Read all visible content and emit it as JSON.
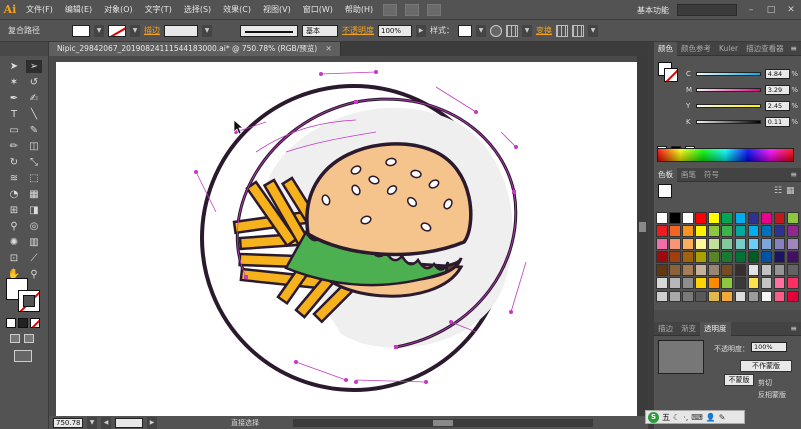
{
  "app": {
    "logo": "Ai"
  },
  "menu": [
    "文件(F)",
    "编辑(E)",
    "对象(O)",
    "文字(T)",
    "选择(S)",
    "效果(C)",
    "视图(V)",
    "窗口(W)",
    "帮助(H)"
  ],
  "workspace": "基本功能",
  "window_controls": [
    "–",
    "□",
    "✕"
  ],
  "control_bar": {
    "selection_label": "复合路径",
    "stroke_link": "描边",
    "stroke_weight_label": "",
    "brush_label": "基本",
    "opacity_link": "不透明度",
    "opacity_value": "100%",
    "style_label": "样式：",
    "transform_link": "变换"
  },
  "document_tab": {
    "title": "Nipic_29842067_20190824111544183000.ai* @ 750.78% (RGB/预览)",
    "close": "✕"
  },
  "status": {
    "zoom": "750.78",
    "page": "1",
    "status_text": "直接选择"
  },
  "panels": {
    "color_tabs": [
      "颜色",
      "颜色参考",
      "Kuler",
      "描边查看器"
    ],
    "cmyk": [
      {
        "label": "C",
        "value": "4.84",
        "color": "#00aeef"
      },
      {
        "label": "M",
        "value": "3.29",
        "color": "#ec008c"
      },
      {
        "label": "Y",
        "value": "2.45",
        "color": "#fff200"
      },
      {
        "label": "K",
        "value": "0.11",
        "color": "#000000"
      }
    ],
    "swatch_tabs": [
      "色板",
      "画笔",
      "符号"
    ],
    "swatches": [
      "#ffffff",
      "#000000",
      "#ffffff",
      "#ff0000",
      "#ffff00",
      "#00a651",
      "#00aeef",
      "#2e3192",
      "#ec008c",
      "#c4161c",
      "#8dc63f",
      "#ed1c24",
      "#f26522",
      "#f7941d",
      "#fff200",
      "#8dc63f",
      "#39b54a",
      "#00a99d",
      "#00aeef",
      "#0072bc",
      "#2e3192",
      "#92278f",
      "#f06eaa",
      "#f69679",
      "#fbaf5d",
      "#fff799",
      "#c4df9b",
      "#82ca9c",
      "#7accc8",
      "#6dcff6",
      "#7da7d9",
      "#8781bd",
      "#a186be",
      "#9e0b0f",
      "#a0410d",
      "#a3620a",
      "#aba000",
      "#598527",
      "#197b30",
      "#007236",
      "#005e20",
      "#0054a6",
      "#1b1464",
      "#440e62",
      "#603913",
      "#8c6239",
      "#a67c52",
      "#c7b299",
      "#998675",
      "#754c24",
      "#362f2d",
      "#e3e3e3",
      "#c2c2c2",
      "#959595",
      "#636363",
      "#d8d8d8",
      "#b7b7b7",
      "#8e8e8e",
      "#ffd400",
      "#ff8a00",
      "#8dc63f",
      "#3a3a3a",
      "#ffe14d",
      "#c4c4c4",
      "#ff6fa0",
      "#ff2e63",
      "#cfcfcf",
      "#a9a9a9",
      "#7a7a7a",
      "#595959",
      "#e0b84d",
      "#f2a93b",
      "#dcdcdc",
      "#9c9c9c",
      "#f5f5f5",
      "#ff5c8a",
      "#e6003a"
    ],
    "bottom_tabs": [
      "描边",
      "渐变",
      "透明度"
    ],
    "transparency": {
      "opacity_label": "不透明度：",
      "opacity_value": "100%",
      "btn_mask": "不作蒙版",
      "btn_mask2": "不蒙版",
      "chk_clip": "剪切",
      "chk_invert": "反相蒙版"
    }
  },
  "ime": {
    "logo": "S",
    "mode": "五",
    "icons": [
      "☾",
      "·,",
      "⌨",
      "👤",
      "✎"
    ]
  }
}
